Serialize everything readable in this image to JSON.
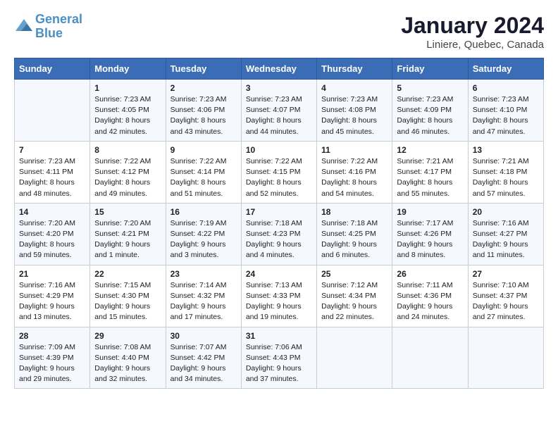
{
  "logo": {
    "line1": "General",
    "line2": "Blue"
  },
  "title": "January 2024",
  "subtitle": "Liniere, Quebec, Canada",
  "headers": [
    "Sunday",
    "Monday",
    "Tuesday",
    "Wednesday",
    "Thursday",
    "Friday",
    "Saturday"
  ],
  "rows": [
    [
      {
        "day": "",
        "lines": []
      },
      {
        "day": "1",
        "lines": [
          "Sunrise: 7:23 AM",
          "Sunset: 4:05 PM",
          "Daylight: 8 hours",
          "and 42 minutes."
        ]
      },
      {
        "day": "2",
        "lines": [
          "Sunrise: 7:23 AM",
          "Sunset: 4:06 PM",
          "Daylight: 8 hours",
          "and 43 minutes."
        ]
      },
      {
        "day": "3",
        "lines": [
          "Sunrise: 7:23 AM",
          "Sunset: 4:07 PM",
          "Daylight: 8 hours",
          "and 44 minutes."
        ]
      },
      {
        "day": "4",
        "lines": [
          "Sunrise: 7:23 AM",
          "Sunset: 4:08 PM",
          "Daylight: 8 hours",
          "and 45 minutes."
        ]
      },
      {
        "day": "5",
        "lines": [
          "Sunrise: 7:23 AM",
          "Sunset: 4:09 PM",
          "Daylight: 8 hours",
          "and 46 minutes."
        ]
      },
      {
        "day": "6",
        "lines": [
          "Sunrise: 7:23 AM",
          "Sunset: 4:10 PM",
          "Daylight: 8 hours",
          "and 47 minutes."
        ]
      }
    ],
    [
      {
        "day": "7",
        "lines": [
          "Sunrise: 7:23 AM",
          "Sunset: 4:11 PM",
          "Daylight: 8 hours",
          "and 48 minutes."
        ]
      },
      {
        "day": "8",
        "lines": [
          "Sunrise: 7:22 AM",
          "Sunset: 4:12 PM",
          "Daylight: 8 hours",
          "and 49 minutes."
        ]
      },
      {
        "day": "9",
        "lines": [
          "Sunrise: 7:22 AM",
          "Sunset: 4:14 PM",
          "Daylight: 8 hours",
          "and 51 minutes."
        ]
      },
      {
        "day": "10",
        "lines": [
          "Sunrise: 7:22 AM",
          "Sunset: 4:15 PM",
          "Daylight: 8 hours",
          "and 52 minutes."
        ]
      },
      {
        "day": "11",
        "lines": [
          "Sunrise: 7:22 AM",
          "Sunset: 4:16 PM",
          "Daylight: 8 hours",
          "and 54 minutes."
        ]
      },
      {
        "day": "12",
        "lines": [
          "Sunrise: 7:21 AM",
          "Sunset: 4:17 PM",
          "Daylight: 8 hours",
          "and 55 minutes."
        ]
      },
      {
        "day": "13",
        "lines": [
          "Sunrise: 7:21 AM",
          "Sunset: 4:18 PM",
          "Daylight: 8 hours",
          "and 57 minutes."
        ]
      }
    ],
    [
      {
        "day": "14",
        "lines": [
          "Sunrise: 7:20 AM",
          "Sunset: 4:20 PM",
          "Daylight: 8 hours",
          "and 59 minutes."
        ]
      },
      {
        "day": "15",
        "lines": [
          "Sunrise: 7:20 AM",
          "Sunset: 4:21 PM",
          "Daylight: 9 hours",
          "and 1 minute."
        ]
      },
      {
        "day": "16",
        "lines": [
          "Sunrise: 7:19 AM",
          "Sunset: 4:22 PM",
          "Daylight: 9 hours",
          "and 3 minutes."
        ]
      },
      {
        "day": "17",
        "lines": [
          "Sunrise: 7:18 AM",
          "Sunset: 4:23 PM",
          "Daylight: 9 hours",
          "and 4 minutes."
        ]
      },
      {
        "day": "18",
        "lines": [
          "Sunrise: 7:18 AM",
          "Sunset: 4:25 PM",
          "Daylight: 9 hours",
          "and 6 minutes."
        ]
      },
      {
        "day": "19",
        "lines": [
          "Sunrise: 7:17 AM",
          "Sunset: 4:26 PM",
          "Daylight: 9 hours",
          "and 8 minutes."
        ]
      },
      {
        "day": "20",
        "lines": [
          "Sunrise: 7:16 AM",
          "Sunset: 4:27 PM",
          "Daylight: 9 hours",
          "and 11 minutes."
        ]
      }
    ],
    [
      {
        "day": "21",
        "lines": [
          "Sunrise: 7:16 AM",
          "Sunset: 4:29 PM",
          "Daylight: 9 hours",
          "and 13 minutes."
        ]
      },
      {
        "day": "22",
        "lines": [
          "Sunrise: 7:15 AM",
          "Sunset: 4:30 PM",
          "Daylight: 9 hours",
          "and 15 minutes."
        ]
      },
      {
        "day": "23",
        "lines": [
          "Sunrise: 7:14 AM",
          "Sunset: 4:32 PM",
          "Daylight: 9 hours",
          "and 17 minutes."
        ]
      },
      {
        "day": "24",
        "lines": [
          "Sunrise: 7:13 AM",
          "Sunset: 4:33 PM",
          "Daylight: 9 hours",
          "and 19 minutes."
        ]
      },
      {
        "day": "25",
        "lines": [
          "Sunrise: 7:12 AM",
          "Sunset: 4:34 PM",
          "Daylight: 9 hours",
          "and 22 minutes."
        ]
      },
      {
        "day": "26",
        "lines": [
          "Sunrise: 7:11 AM",
          "Sunset: 4:36 PM",
          "Daylight: 9 hours",
          "and 24 minutes."
        ]
      },
      {
        "day": "27",
        "lines": [
          "Sunrise: 7:10 AM",
          "Sunset: 4:37 PM",
          "Daylight: 9 hours",
          "and 27 minutes."
        ]
      }
    ],
    [
      {
        "day": "28",
        "lines": [
          "Sunrise: 7:09 AM",
          "Sunset: 4:39 PM",
          "Daylight: 9 hours",
          "and 29 minutes."
        ]
      },
      {
        "day": "29",
        "lines": [
          "Sunrise: 7:08 AM",
          "Sunset: 4:40 PM",
          "Daylight: 9 hours",
          "and 32 minutes."
        ]
      },
      {
        "day": "30",
        "lines": [
          "Sunrise: 7:07 AM",
          "Sunset: 4:42 PM",
          "Daylight: 9 hours",
          "and 34 minutes."
        ]
      },
      {
        "day": "31",
        "lines": [
          "Sunrise: 7:06 AM",
          "Sunset: 4:43 PM",
          "Daylight: 9 hours",
          "and 37 minutes."
        ]
      },
      {
        "day": "",
        "lines": []
      },
      {
        "day": "",
        "lines": []
      },
      {
        "day": "",
        "lines": []
      }
    ]
  ]
}
